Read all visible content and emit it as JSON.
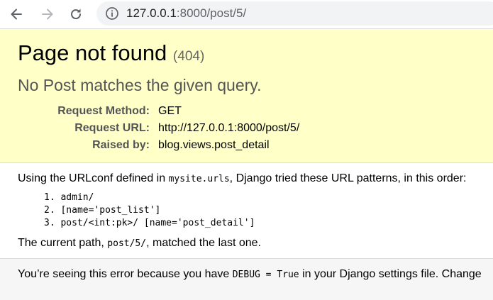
{
  "browser": {
    "url_host": "127.0.0.1",
    "url_port_path": ":8000/post/5/",
    "back_icon": "arrow-left-icon",
    "forward_icon": "arrow-right-icon",
    "reload_icon": "reload-icon",
    "info_icon": "info-icon"
  },
  "summary": {
    "title": "Page not found",
    "status": "(404)",
    "message": "No Post matches the given query.",
    "meta": [
      {
        "label": "Request Method:",
        "value": "GET"
      },
      {
        "label": "Request URL:",
        "value": "http://127.0.0.1:8000/post/5/"
      },
      {
        "label": "Raised by:",
        "value": "blog.views.post_detail"
      }
    ]
  },
  "info": {
    "urlconf_prefix": "Using the URLconf defined in ",
    "urlconf_module": "mysite.urls",
    "urlconf_suffix": ", Django tried these URL patterns, in this order:",
    "patterns": [
      "1. admin/",
      "2. [name='post_list']",
      "3. post/<int:pk>/ [name='post_detail']"
    ],
    "current_prefix": "The current path, ",
    "current_path": "post/5/",
    "current_suffix": ", matched the last one."
  },
  "explanation": {
    "prefix": "You’re seeing this error because you have ",
    "debug_setting": "DEBUG = True",
    "suffix": " in your Django settings file. Change"
  },
  "colors": {
    "summary_bg": "#ffffc8",
    "explanation_bg": "#f6f6f6",
    "omnibox_bg": "#f1f3f4"
  }
}
